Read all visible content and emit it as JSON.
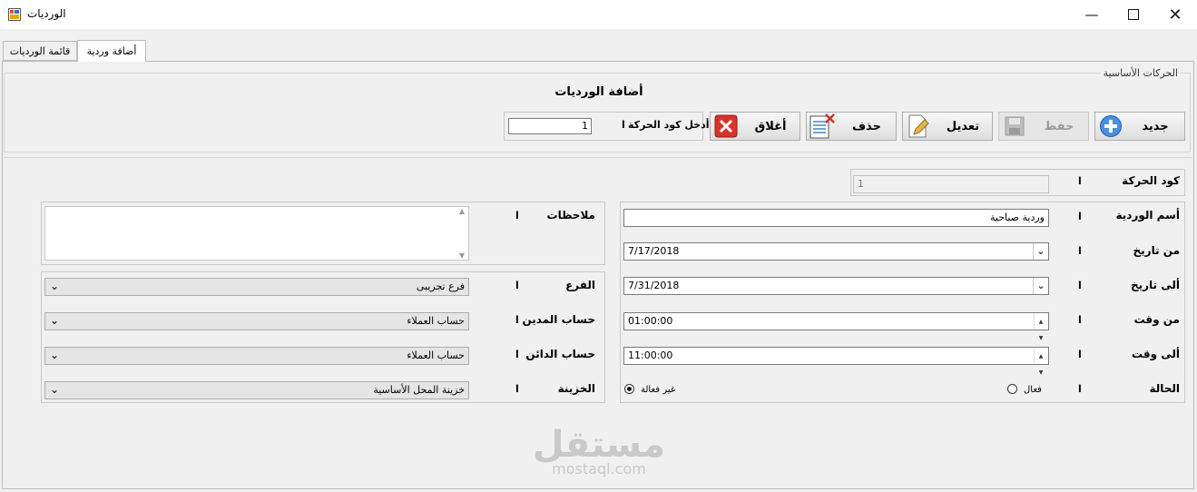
{
  "window": {
    "title": "الورديات",
    "icon": "app-window-icon"
  },
  "tabs": {
    "active": "أضافة وردية",
    "list": "قائمة الورديات"
  },
  "group": {
    "legend": "الحركات الأساسية",
    "heading": "أضافة الورديات"
  },
  "toolbar": {
    "new_label": "جديد",
    "save_label": "حفظ",
    "edit_label": "تعديل",
    "delete_label": "حذف",
    "close_label": "أغلاق",
    "code_prompt": "أدخل كود الحركة",
    "code_value": "1",
    "separator": "ا"
  },
  "form": {
    "sep": "ا",
    "code": {
      "label": "كود الحركة",
      "value": "1"
    },
    "shift_name": {
      "label": "أسم الوردية",
      "value": "وردية صباحية"
    },
    "from_date": {
      "label": "من تاريخ",
      "value": "7/17/2018"
    },
    "to_date": {
      "label": "ألى تاريخ",
      "value": "7/31/2018"
    },
    "from_time": {
      "label": "من وقت",
      "value": "01:00:00"
    },
    "to_time": {
      "label": "ألى وقت",
      "value": "11:00:00"
    },
    "status": {
      "label": "الحالة",
      "option_active": "فعال",
      "option_inactive": "غير فعالة",
      "selected": "غير فعالة"
    },
    "notes": {
      "label": "ملاحظات",
      "value": ""
    },
    "branch": {
      "label": "الفرع",
      "value": "فرع تجريبى"
    },
    "debit_account": {
      "label": "حساب المدين",
      "value": "حساب العملاء"
    },
    "credit_account": {
      "label": "حساب الدائن",
      "value": "حساب العملاء"
    },
    "treasury": {
      "label": "الخزينة",
      "value": "خزينة المحل الأساسية"
    }
  },
  "watermark": {
    "arabic": "مستقل",
    "english": "mostaql.com"
  }
}
